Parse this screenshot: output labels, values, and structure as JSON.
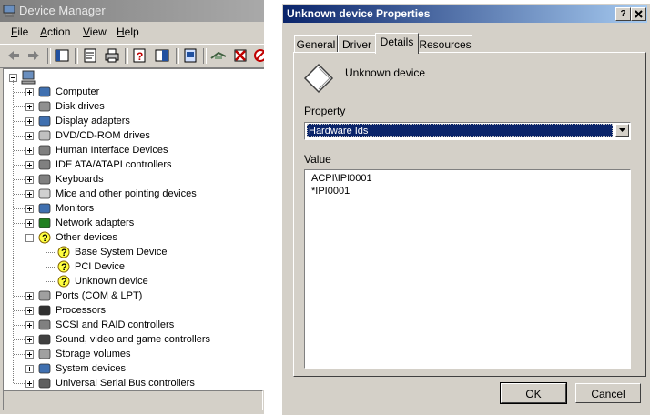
{
  "device_manager": {
    "title": "Device Manager",
    "menu": [
      {
        "label": "File",
        "underline": "F",
        "rest": "ile"
      },
      {
        "label": "Action",
        "underline": "A",
        "rest": "ction"
      },
      {
        "label": "View",
        "underline": "V",
        "rest": "iew"
      },
      {
        "label": "Help",
        "underline": "H",
        "rest": "elp"
      }
    ],
    "toolbar_icons": [
      "back-icon",
      "forward-icon",
      "console-tree-icon",
      "properties-icon",
      "print-icon",
      "help-icon",
      "show-hide-icon",
      "update-driver-icon",
      "scan-hardware-icon",
      "uninstall-icon",
      "disable-icon"
    ],
    "tree": [
      {
        "label": "Computer"
      },
      {
        "label": "Disk drives"
      },
      {
        "label": "Display adapters"
      },
      {
        "label": "DVD/CD-ROM drives"
      },
      {
        "label": "Human Interface Devices"
      },
      {
        "label": "IDE ATA/ATAPI controllers"
      },
      {
        "label": "Keyboards"
      },
      {
        "label": "Mice and other pointing devices"
      },
      {
        "label": "Monitors"
      },
      {
        "label": "Network adapters"
      },
      {
        "label": "Other devices"
      },
      {
        "label": "Base System Device"
      },
      {
        "label": "PCI Device"
      },
      {
        "label": "Unknown device"
      },
      {
        "label": "Ports (COM & LPT)"
      },
      {
        "label": "Processors"
      },
      {
        "label": "SCSI and RAID controllers"
      },
      {
        "label": "Sound, video and game controllers"
      },
      {
        "label": "Storage volumes"
      },
      {
        "label": "System devices"
      },
      {
        "label": "Universal Serial Bus controllers"
      }
    ]
  },
  "properties_dialog": {
    "title": "Unknown device Properties",
    "help_btn": "?",
    "close_btn": "X",
    "tabs": [
      {
        "label": "General"
      },
      {
        "label": "Driver"
      },
      {
        "label": "Details",
        "active": true
      },
      {
        "label": "Resources"
      }
    ],
    "device_name": "Unknown device",
    "property_label": "Property",
    "property_value": "Hardware Ids",
    "value_label": "Value",
    "values": [
      "ACPI\\IPI0001",
      "*IPI0001"
    ],
    "ok_label": "OK",
    "cancel_label": "Cancel"
  }
}
